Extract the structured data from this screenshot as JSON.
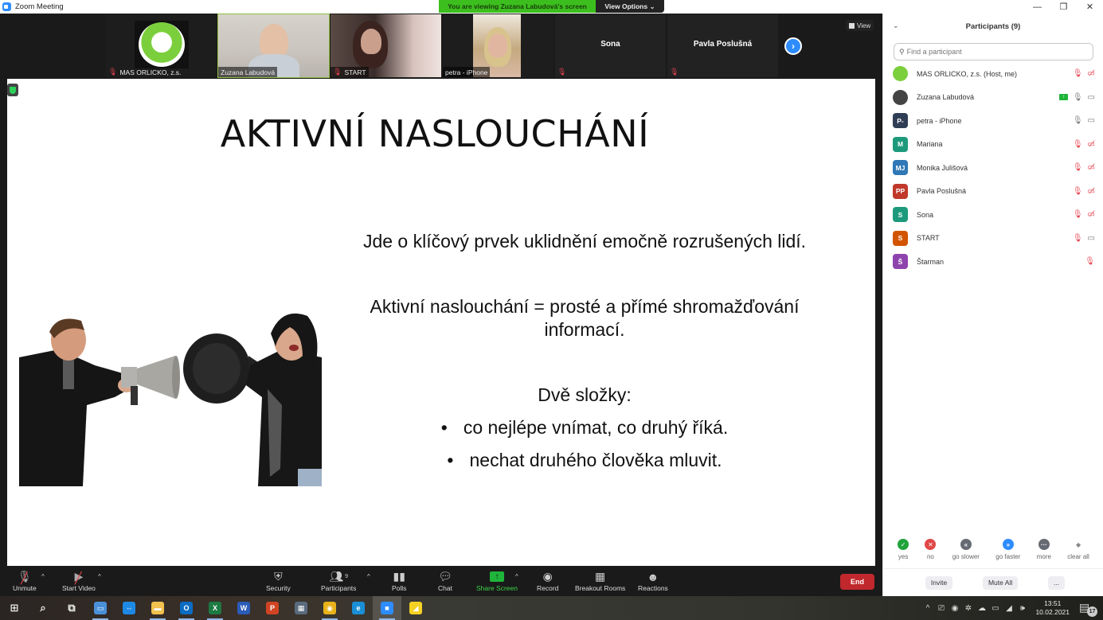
{
  "window": {
    "title": "Zoom Meeting",
    "controls": {
      "minimize": "—",
      "maximize": "❐",
      "close": "✕"
    }
  },
  "banner": {
    "viewing": "You are viewing Zuzana Labudová's screen",
    "view_options": "View Options ⌄"
  },
  "video_strip": {
    "tiles": [
      {
        "name": "MAS ORLICKO, z.s.",
        "muted": true,
        "type": "logo"
      },
      {
        "name": "Zuzana Labudová",
        "muted": false,
        "type": "video",
        "active_speaker": true
      },
      {
        "name": "START",
        "muted": true,
        "type": "video"
      },
      {
        "name": "petra - iPhone",
        "muted": false,
        "type": "video"
      },
      {
        "name": "Sona",
        "muted": true,
        "type": "name-only"
      },
      {
        "name": "Pavla Poslušná",
        "muted": true,
        "type": "name-only"
      }
    ],
    "next_page_icon": "›",
    "view_label": "View"
  },
  "slide": {
    "title": "AKTIVNÍ NASLOUCHÁNÍ",
    "paragraph1": "Jde o klíčový prvek uklidnění emočně rozrušených lidí.",
    "paragraph2_line1": "Aktivní naslouchání = prosté a přímé shromažďování",
    "paragraph2_line2": "informací.",
    "subheading": "Dvě složky:",
    "bullets": [
      "co nejlépe vnímat, co druhý říká.",
      "nechat druhého člověka mluvit."
    ],
    "bullet_glyph": "•",
    "image_description": "man shouting through megaphone at woman covering ear"
  },
  "toolbar": {
    "unmute": "Unmute",
    "start_video": "Start Video",
    "security": "Security",
    "participants": "Participants",
    "participants_count": "9",
    "polls": "Polls",
    "chat": "Chat",
    "share_screen": "Share Screen",
    "record": "Record",
    "breakout_rooms": "Breakout Rooms",
    "reactions": "Reactions",
    "end": "End",
    "caret": "^"
  },
  "participants_panel": {
    "title": "Participants (9)",
    "collapse_icon": "⌄",
    "search_placeholder": "Find a participant",
    "participants": [
      {
        "name": "MAS ORLICKO, z.s. (Host, me)",
        "initials": "",
        "avatar_color": "#7bcf3c",
        "mic": "muted",
        "video": "off"
      },
      {
        "name": "Zuzana Labudová",
        "initials": "",
        "avatar_color": "#444444",
        "mic": "on",
        "video": "on",
        "sharing": true
      },
      {
        "name": "petra - iPhone",
        "initials": "P-",
        "avatar_color": "#2f3e55",
        "mic": "on",
        "video": "on"
      },
      {
        "name": "Mariana",
        "initials": "M",
        "avatar_color": "#1d9a7c",
        "mic": "muted",
        "video": "off"
      },
      {
        "name": "Monika Julišová",
        "initials": "MJ",
        "avatar_color": "#2f77b6",
        "mic": "muted",
        "video": "off"
      },
      {
        "name": "Pavla Poslušná",
        "initials": "PP",
        "avatar_color": "#c0392b",
        "mic": "muted",
        "video": "off"
      },
      {
        "name": "Sona",
        "initials": "S",
        "avatar_color": "#1d9a7c",
        "mic": "muted",
        "video": "off"
      },
      {
        "name": "START",
        "initials": "S",
        "avatar_color": "#d35400",
        "mic": "muted",
        "video": "on"
      },
      {
        "name": "Štarman",
        "initials": "Š",
        "avatar_color": "#8e44ad",
        "mic": "muted",
        "video": "none"
      }
    ],
    "reactions": [
      {
        "label": "yes",
        "glyph": "✓",
        "color": "#1fa33a"
      },
      {
        "label": "no",
        "glyph": "✕",
        "color": "#e04848"
      },
      {
        "label": "go slower",
        "glyph": "«",
        "color": "#666a73"
      },
      {
        "label": "go faster",
        "glyph": "»",
        "color": "#2d8cff"
      },
      {
        "label": "more",
        "glyph": "···",
        "color": "#666a73"
      },
      {
        "label": "clear all",
        "glyph": "◆",
        "color": "#888888"
      }
    ],
    "invite": "Invite",
    "mute_all": "Mute All",
    "more": "..."
  },
  "taskbar": {
    "apps": [
      {
        "name": "start",
        "glyph": "⊞",
        "color": "transparent"
      },
      {
        "name": "search",
        "glyph": "⌕",
        "color": "transparent"
      },
      {
        "name": "task-view",
        "glyph": "⧉",
        "color": "transparent"
      },
      {
        "name": "remote-desktop",
        "glyph": "▭",
        "color": "#4a90d9"
      },
      {
        "name": "teamviewer",
        "glyph": "⇔",
        "color": "#1e88e5"
      },
      {
        "name": "file-explorer",
        "glyph": "▬",
        "color": "#f2c14e"
      },
      {
        "name": "outlook",
        "glyph": "O",
        "color": "#0a6cc2"
      },
      {
        "name": "excel",
        "glyph": "X",
        "color": "#1d7a43"
      },
      {
        "name": "word",
        "glyph": "W",
        "color": "#2b5cb8"
      },
      {
        "name": "powerpoint",
        "glyph": "P",
        "color": "#d04423"
      },
      {
        "name": "calculator",
        "glyph": "▦",
        "color": "#5a6b7e"
      },
      {
        "name": "chrome",
        "glyph": "◉",
        "color": "#e8b21a"
      },
      {
        "name": "edge",
        "glyph": "e",
        "color": "#1a8fd6"
      },
      {
        "name": "zoom",
        "glyph": "■",
        "color": "#2d8cff"
      },
      {
        "name": "sticky-notes",
        "glyph": "◢",
        "color": "#f5d123"
      }
    ],
    "tray_icons": [
      "^",
      "⎚",
      "◉",
      "✲",
      "☁",
      "▭",
      "◢",
      "🕪"
    ],
    "time": "13:51",
    "date": "10.02.2021",
    "notifications": "17"
  }
}
